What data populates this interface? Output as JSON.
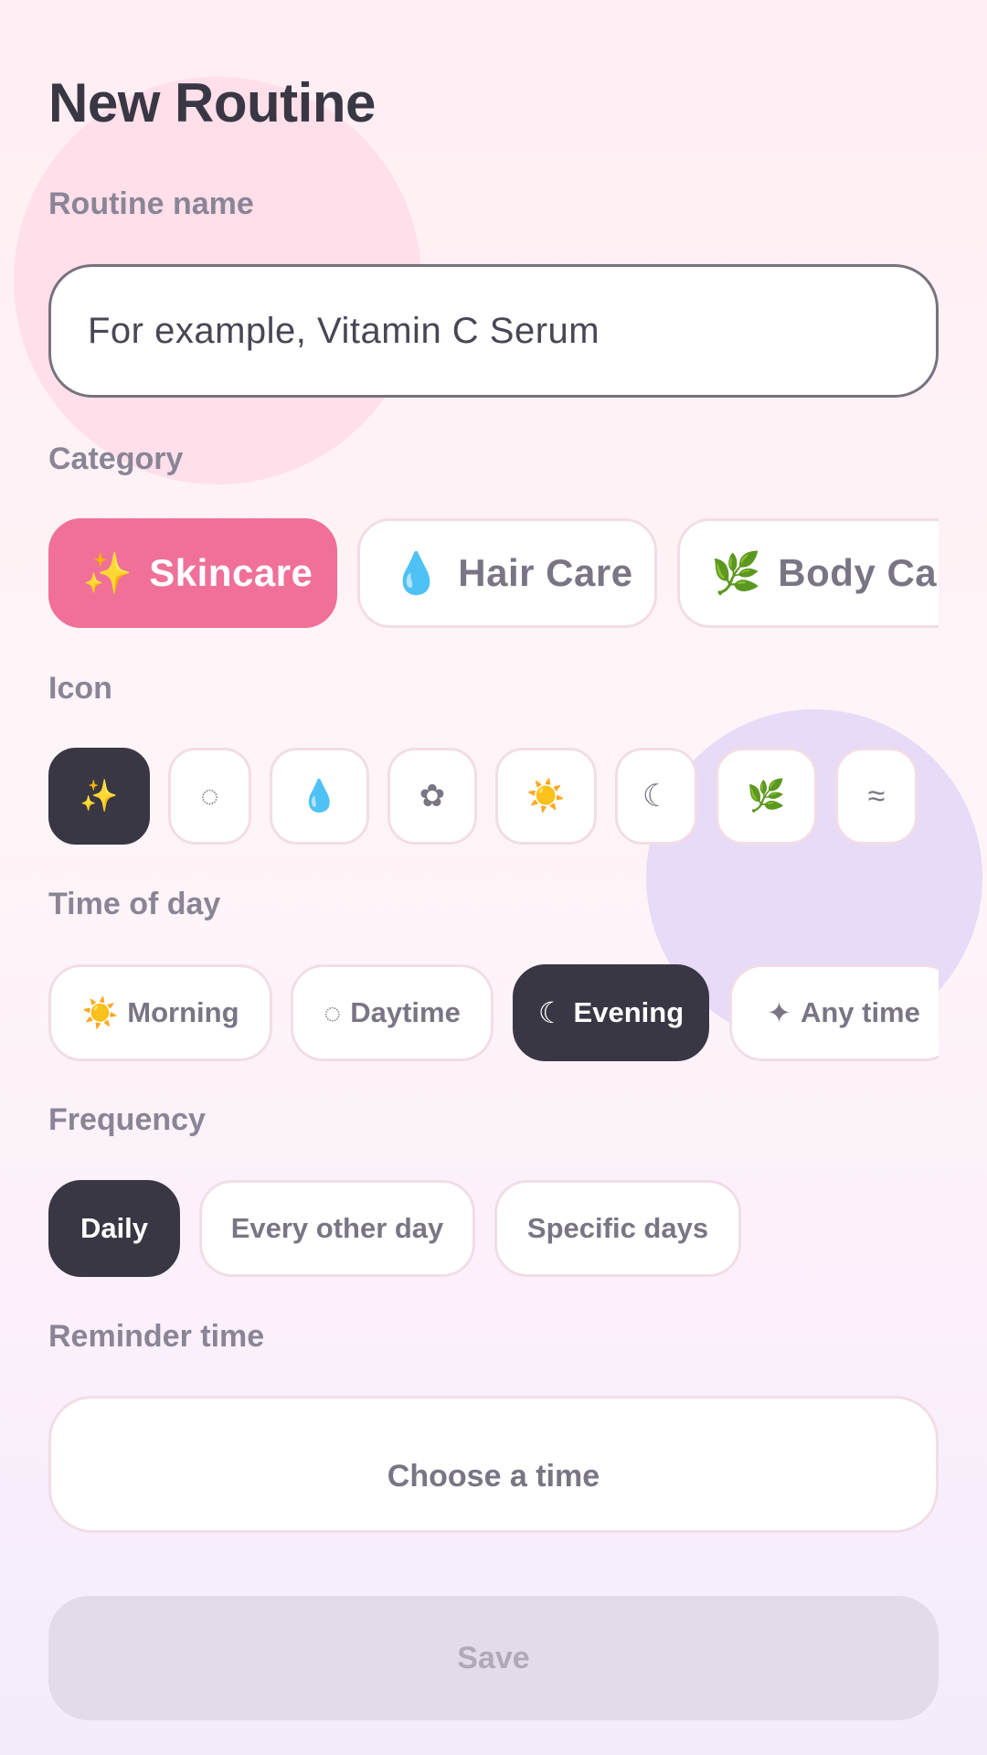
{
  "page": {
    "title": "New Routine"
  },
  "colors": {
    "accent": "#f07098",
    "dark": "#3a3744",
    "muted": "#8a8596"
  },
  "name_field": {
    "label": "Routine name",
    "placeholder": "For example, Vitamin C Serum"
  },
  "category": {
    "label": "Category",
    "items": [
      {
        "icon": "sparkles-icon",
        "glyph": "✨",
        "label": "Skincare",
        "selected": true
      },
      {
        "icon": "droplet-icon",
        "glyph": "💧",
        "label": "Hair Care",
        "selected": false
      },
      {
        "icon": "herb-icon",
        "glyph": "🌿",
        "label": "Body Care",
        "selected": false
      }
    ]
  },
  "icon_picker": {
    "label": "Icon",
    "items": [
      {
        "icon": "sparkles-icon",
        "glyph": "✨",
        "selected": true
      },
      {
        "icon": "dotted-circle-icon",
        "glyph": "◌",
        "selected": false
      },
      {
        "icon": "droplet-icon",
        "glyph": "💧",
        "selected": false
      },
      {
        "icon": "flower-icon",
        "glyph": "✿",
        "selected": false
      },
      {
        "icon": "sun-icon",
        "glyph": "☀️",
        "selected": false
      },
      {
        "icon": "moon-icon",
        "glyph": "☾",
        "selected": false
      },
      {
        "icon": "herb-icon",
        "glyph": "🌿",
        "selected": false
      },
      {
        "icon": "waves-icon",
        "glyph": "≈",
        "selected": false
      }
    ]
  },
  "time_of_day": {
    "label": "Time of day",
    "items": [
      {
        "icon": "sun-icon",
        "glyph": "☀️",
        "label": "Morning",
        "selected": false
      },
      {
        "icon": "dotted-circle-icon",
        "glyph": "◌",
        "label": "Daytime",
        "selected": false
      },
      {
        "icon": "moon-icon",
        "glyph": "☾",
        "label": "Evening",
        "selected": true
      },
      {
        "icon": "four-point-star-icon",
        "glyph": "✦",
        "label": "Any time",
        "selected": false
      }
    ]
  },
  "frequency": {
    "label": "Frequency",
    "items": [
      {
        "label": "Daily",
        "selected": true
      },
      {
        "label": "Every other day",
        "selected": false
      },
      {
        "label": "Specific days",
        "selected": false
      }
    ]
  },
  "reminder": {
    "label": "Reminder time",
    "placeholder": "Choose a time"
  },
  "save": {
    "label": "Save",
    "enabled": false
  }
}
